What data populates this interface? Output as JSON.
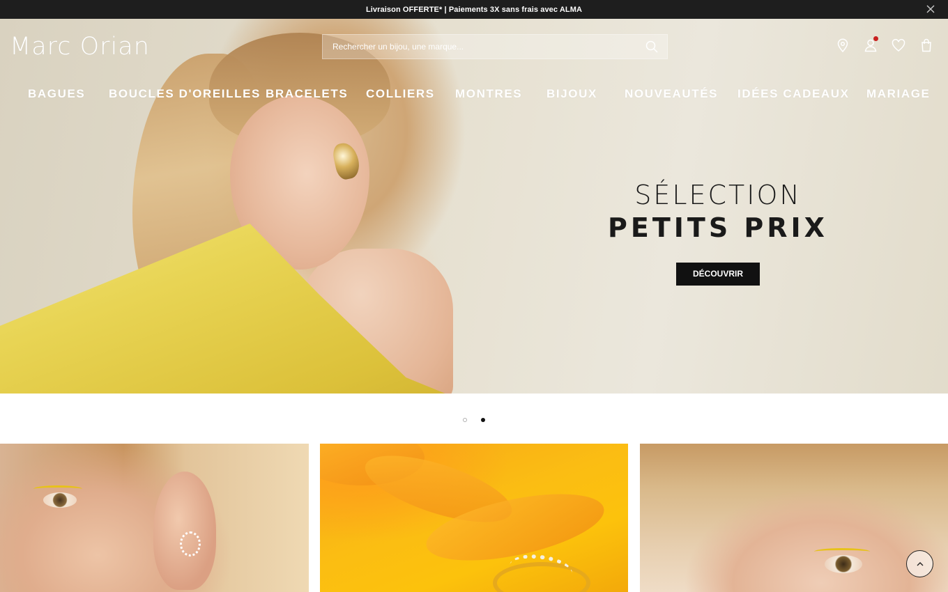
{
  "announcement": {
    "text": "Livraison OFFERTE* | Paiements 3X sans frais avec ALMA",
    "close_icon": "close-icon"
  },
  "header": {
    "logo": "Marc Orian",
    "search": {
      "placeholder": "Rechercher un bijou, une marque...",
      "value": "",
      "icon": "search-icon"
    },
    "icons": [
      "store-locator-pin-icon",
      "account-user-icon",
      "wishlist-heart-icon",
      "shopping-bag-icon"
    ],
    "account_notification_color": "#c8201f"
  },
  "nav": {
    "items": [
      "BAGUES",
      "BOUCLES D'OREILLES",
      "BRACELETS",
      "COLLIERS",
      "MONTRES",
      "BIJOUX",
      "NOUVEAUTÉS",
      "IDÉES CADEAUX",
      "MARIAGE"
    ]
  },
  "hero": {
    "title_line1": "SÉLECTION",
    "title_line2": "PETITS PRIX",
    "cta": "DÉCOUVRIR",
    "slides_total": 2,
    "active_slide": 2
  },
  "tiles": [
    "earrings-model-photo",
    "ring-on-yellow-flower-photo",
    "model-face-photo"
  ],
  "scroll_top_icon": "chevron-up-icon",
  "colors": {
    "topbar": "#1e1e1e",
    "cta": "#111111",
    "accent_yellow": "#e7c21a"
  }
}
